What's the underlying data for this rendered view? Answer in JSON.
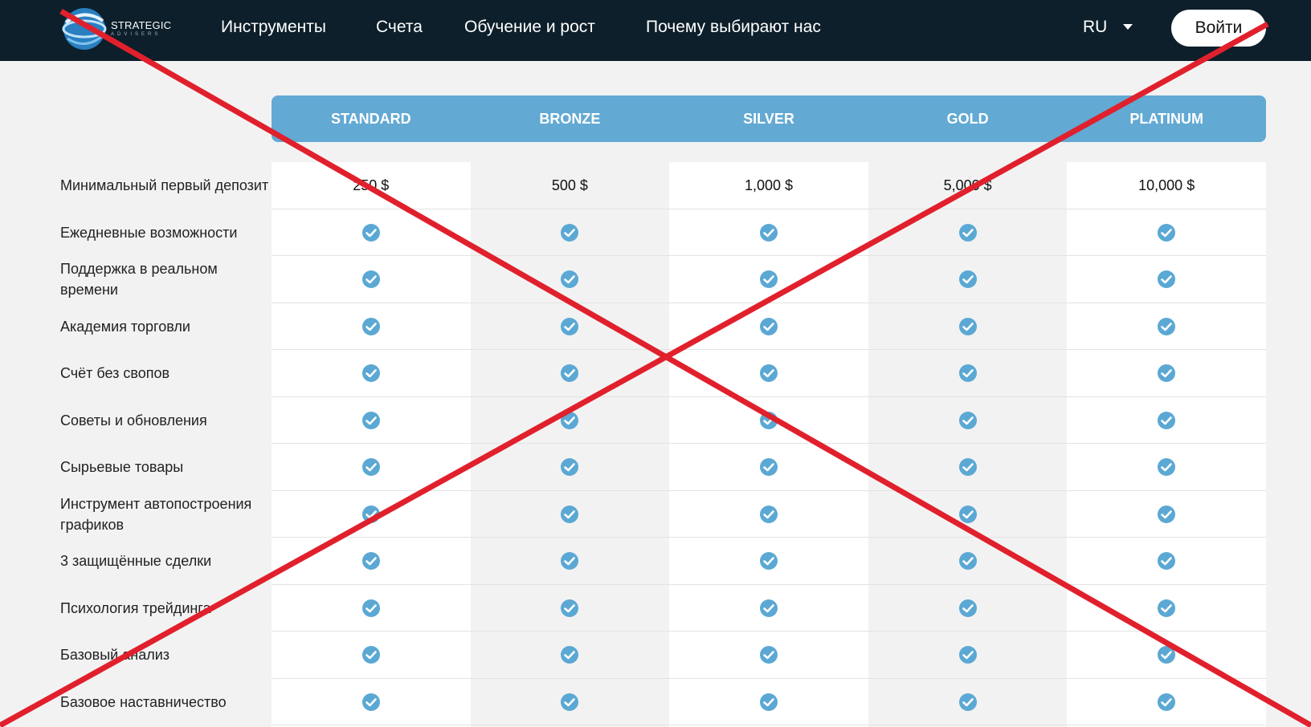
{
  "header": {
    "brand": "STRATEGIC",
    "brand_sub": "ADVISERS",
    "nav": [
      "Инструменты",
      "Счета",
      "Обучение и рост",
      "Почему выбирают нас"
    ],
    "language": "RU",
    "login_label": "Войти"
  },
  "plans": [
    "STANDARD",
    "BRONZE",
    "SILVER",
    "GOLD",
    "PLATINUM"
  ],
  "deposit": {
    "label": "Минимальный первый депозит",
    "values": [
      "250 $",
      "500 $",
      "1,000 $",
      "5,000 $",
      "10,000 $"
    ]
  },
  "features": [
    "Ежедневные возможности",
    "Поддержка в реальном времени",
    "Академия торговли",
    "Счёт без свопов",
    "Советы и обновления",
    "Сырьевые товары",
    "Инструмент автопостроения графиков",
    "3 защищённые сделки",
    "Психология трейдинга",
    "Базовый анализ",
    "Базовое наставничество"
  ],
  "colors": {
    "navbar": "#0c1f2a",
    "accent": "#62a9d3",
    "check": "#5ba8d4",
    "cross": "#e0202c"
  },
  "icons": {
    "check": "check-circle-icon",
    "dropdown": "caret-down-icon",
    "logo": "globe-logo-icon"
  }
}
